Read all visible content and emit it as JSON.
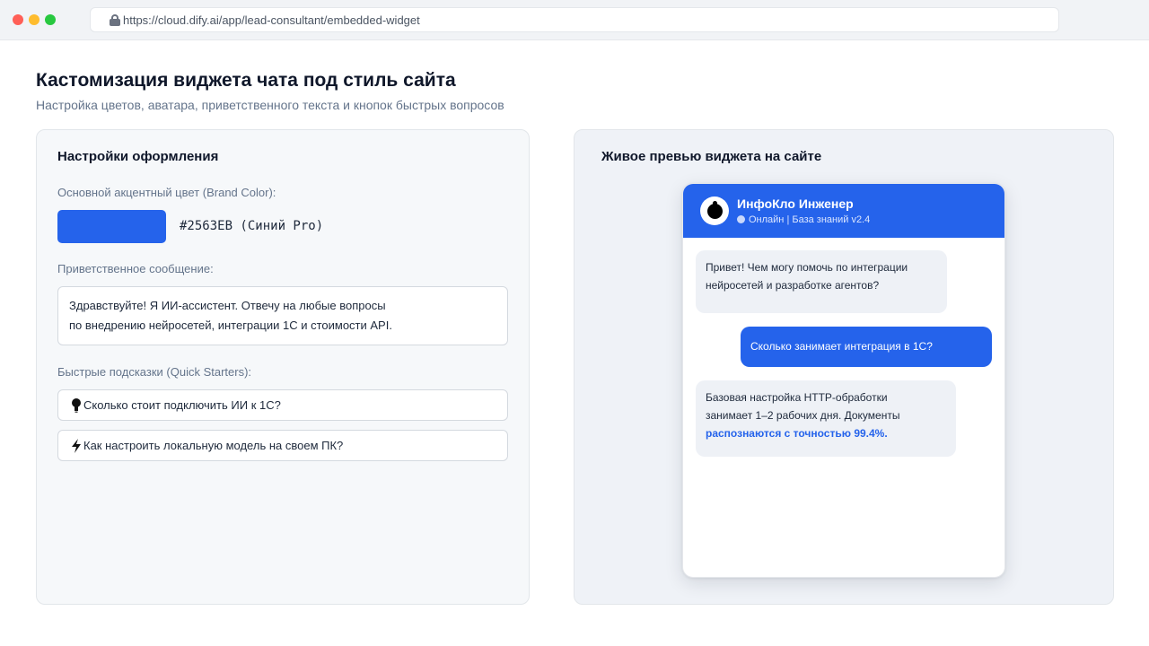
{
  "browser": {
    "url": "https://cloud.dify.ai/app/lead-consultant/embedded-widget"
  },
  "page": {
    "title": "Кастомизация виджета чата под стиль сайта",
    "subtitle": "Настройка цветов, аватара, приветственного текста и кнопок быстрых вопросов"
  },
  "settings": {
    "title": "Настройки оформления",
    "brand_color_label": "Основной акцентный цвет (Brand Color):",
    "brand_color": "#2563EB",
    "brand_color_text": "#2563EB (Синий Pro)",
    "greeting_label": "Приветственное сообщение:",
    "greeting_lines": [
      "Здравствуйте! Я ИИ-ассистент. Отвечу на любые вопросы",
      "по внедрению нейросетей, интеграции 1С и стоимости API."
    ],
    "starters_label": "Быстрые подсказки (Quick Starters):",
    "starters": [
      {
        "icon": "lightbulb-icon",
        "text": "Сколько стоит подключить ИИ к 1С?"
      },
      {
        "icon": "lightning-icon",
        "text": "Как настроить локальную модель на своем ПК?"
      }
    ]
  },
  "preview": {
    "title": "Живое превью виджета на сайте",
    "widget": {
      "name": "ИнфоКло Инженер",
      "status": "Онлайн | База знаний v2.4",
      "messages": [
        {
          "role": "bot",
          "lines": [
            "Привет! Чем могу помочь по интеграции",
            "нейросетей и разработке агентов?"
          ]
        },
        {
          "role": "user",
          "lines": [
            "Сколько занимает интеграция в 1С?"
          ]
        },
        {
          "role": "bot",
          "lines": [
            "Базовая настройка HTTP-обработки",
            "занимает 1–2 рабочих дня. Документы"
          ],
          "highlight": "распознаются с точностью 99.4%."
        }
      ]
    }
  },
  "colors": {
    "accent": "#2563EB",
    "page_bg": "#FFFFFF",
    "bot_bubble": "#EEF1F6"
  }
}
